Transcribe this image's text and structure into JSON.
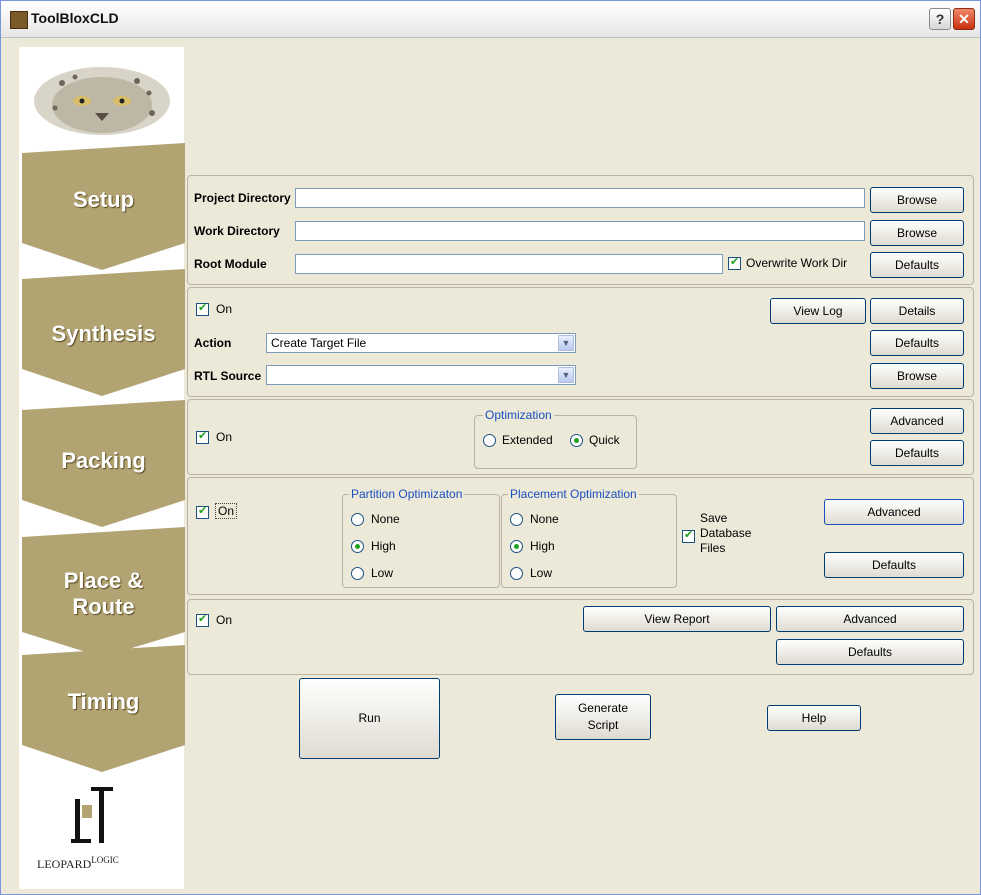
{
  "window": {
    "title": "ToolBloxCLD",
    "help_symbol": "?",
    "close_symbol": "✕"
  },
  "sidebar": {
    "tabs": [
      "Setup",
      "Synthesis",
      "Packing",
      "Place &\nRoute",
      "Timing"
    ],
    "logo_text": "LEOPARD",
    "logo_text_super": "LOGIC"
  },
  "setup": {
    "project_dir_label": "Project Directory",
    "project_dir_value": "",
    "work_dir_label": "Work Directory",
    "work_dir_value": "",
    "root_module_label": "Root Module",
    "root_module_value": "",
    "browse1": "Browse",
    "browse2": "Browse",
    "overwrite_label": "Overwrite Work Dir",
    "overwrite_checked": true,
    "defaults": "Defaults"
  },
  "synthesis": {
    "on_label": "On",
    "on_checked": true,
    "view_log": "View Log",
    "details": "Details",
    "action_label": "Action",
    "action_value": "Create Target File",
    "defaults": "Defaults",
    "rtl_label": "RTL Source",
    "rtl_value": "",
    "browse": "Browse"
  },
  "packing": {
    "on_label": "On",
    "on_checked": true,
    "optimization_title": "Optimization",
    "extended": "Extended",
    "quick": "Quick",
    "selected": "Quick",
    "advanced": "Advanced",
    "defaults": "Defaults"
  },
  "place_route": {
    "on_label": "On",
    "on_checked": true,
    "partition_title": "Partition Optimizaton",
    "placement_title": "Placement Optimization",
    "options": [
      "None",
      "High",
      "Low"
    ],
    "partition_selected": "High",
    "placement_selected": "High",
    "save_db_label": "Save\nDatabase\nFiles",
    "save_db_checked": true,
    "advanced": "Advanced",
    "defaults": "Defaults"
  },
  "timing": {
    "on_label": "On",
    "on_checked": true,
    "view_report": "View Report",
    "advanced": "Advanced",
    "defaults": "Defaults"
  },
  "footer": {
    "run": "Run",
    "generate_script": "Generate\nScript",
    "help": "Help"
  },
  "colors": {
    "tab_gold": "#b2a373",
    "title_blue": "#1a4fc0",
    "check_green": "#21a121"
  }
}
